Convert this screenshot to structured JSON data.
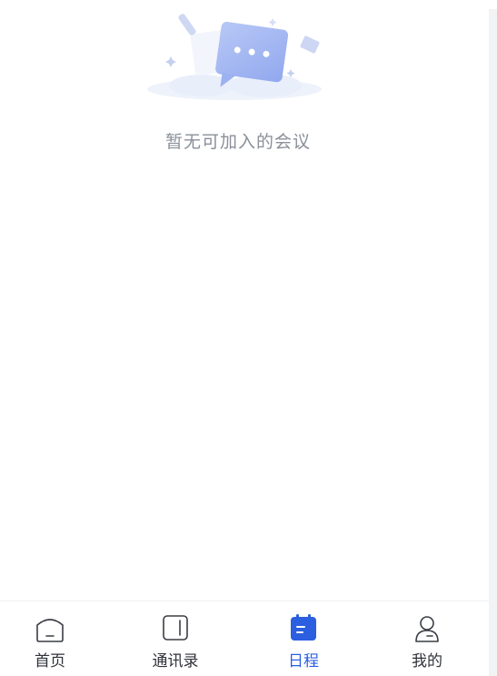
{
  "empty_state": {
    "message": "暂无可加入的会议"
  },
  "tabbar": {
    "items": [
      {
        "label": "首页",
        "icon": "home-icon",
        "active": false
      },
      {
        "label": "通讯录",
        "icon": "contacts-icon",
        "active": false
      },
      {
        "label": "日程",
        "icon": "calendar-icon",
        "active": true
      },
      {
        "label": "我的",
        "icon": "profile-icon",
        "active": false
      }
    ]
  },
  "colors": {
    "accent": "#2b5fe0",
    "inactive_text": "#2f3238",
    "empty_text": "#8a8f99",
    "icon_outline": "#3a3d44"
  }
}
